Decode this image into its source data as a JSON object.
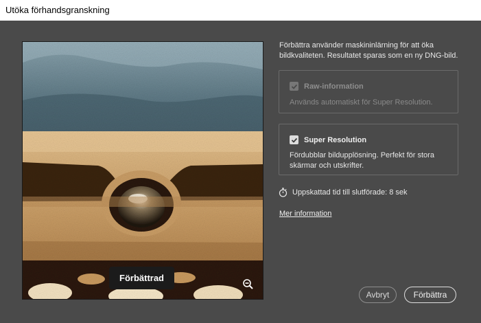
{
  "window": {
    "title": "Utöka förhandsgranskning"
  },
  "description": "Förbättra använder maskininlärning för att öka bildkvaliteten. Resultatet sparas som en ny DNG-bild.",
  "preview": {
    "badge_label": "Förbättrad",
    "zoom_icon": "zoom-out-icon"
  },
  "options": {
    "raw": {
      "label": "Raw-information",
      "description": "Används automatiskt för Super Resolution.",
      "checked": true,
      "disabled": true
    },
    "super_resolution": {
      "label": "Super Resolution",
      "description": "Fördubblar bildupplösning. Perfekt för stora skärmar och utskrifter.",
      "checked": true,
      "disabled": false
    }
  },
  "estimate": {
    "icon": "stopwatch-icon",
    "text": "Uppskattad tid till slutförade: 8 sek"
  },
  "more_info_link": "Mer information",
  "buttons": {
    "cancel": "Avbryt",
    "enhance": "Förbättra"
  },
  "colors": {
    "dialog_bg": "#4a4a4a",
    "titlebar_bg": "#ffffff",
    "badge_bg": "#1b1b1b"
  }
}
